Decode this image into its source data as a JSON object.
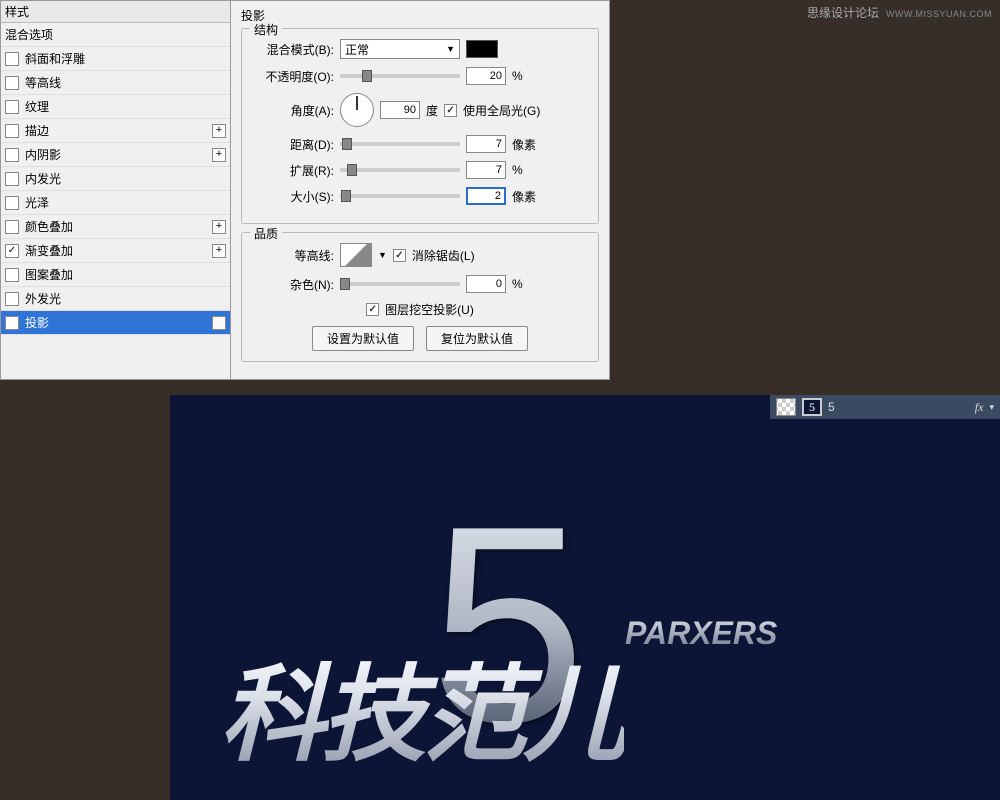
{
  "watermark": {
    "text": "思缘设计论坛",
    "url": "WWW.MISSYUAN.COM"
  },
  "dialog": {
    "styles_header": "样式",
    "blending_options": "混合选项",
    "items": [
      {
        "label": "斜面和浮雕",
        "checked": false,
        "plus": false
      },
      {
        "label": "等高线",
        "checked": false,
        "plus": false
      },
      {
        "label": "纹理",
        "checked": false,
        "plus": false
      },
      {
        "label": "描边",
        "checked": false,
        "plus": true
      },
      {
        "label": "内阴影",
        "checked": false,
        "plus": true
      },
      {
        "label": "内发光",
        "checked": false,
        "plus": false
      },
      {
        "label": "光泽",
        "checked": false,
        "plus": false
      },
      {
        "label": "颜色叠加",
        "checked": false,
        "plus": true
      },
      {
        "label": "渐变叠加",
        "checked": true,
        "plus": true
      },
      {
        "label": "图案叠加",
        "checked": false,
        "plus": false
      },
      {
        "label": "外发光",
        "checked": false,
        "plus": false
      },
      {
        "label": "投影",
        "checked": true,
        "plus": true,
        "selected": true
      }
    ],
    "panel_title": "投影",
    "structure": {
      "legend": "结构",
      "blend_mode_label": "混合模式(B):",
      "blend_mode_value": "正常",
      "opacity_label": "不透明度(O):",
      "opacity_value": "20",
      "opacity_unit": "%",
      "angle_label": "角度(A):",
      "angle_value": "90",
      "angle_unit": "度",
      "global_light_label": "使用全局光(G)",
      "distance_label": "距离(D):",
      "distance_value": "7",
      "distance_unit": "像素",
      "spread_label": "扩展(R):",
      "spread_value": "7",
      "spread_unit": "%",
      "size_label": "大小(S):",
      "size_value": "2",
      "size_unit": "像素"
    },
    "quality": {
      "legend": "品质",
      "contour_label": "等高线:",
      "antialias_label": "消除锯齿(L)",
      "noise_label": "杂色(N):",
      "noise_value": "0",
      "noise_unit": "%",
      "knockout_label": "图层挖空投影(U)"
    },
    "buttons": {
      "default": "设置为默认值",
      "reset": "复位为默认值"
    }
  },
  "layer_bar": {
    "name": "5",
    "thumb_text": "5"
  },
  "artwork": {
    "five": "5",
    "chinese": "科技范儿",
    "parxers": "PARXERS"
  }
}
